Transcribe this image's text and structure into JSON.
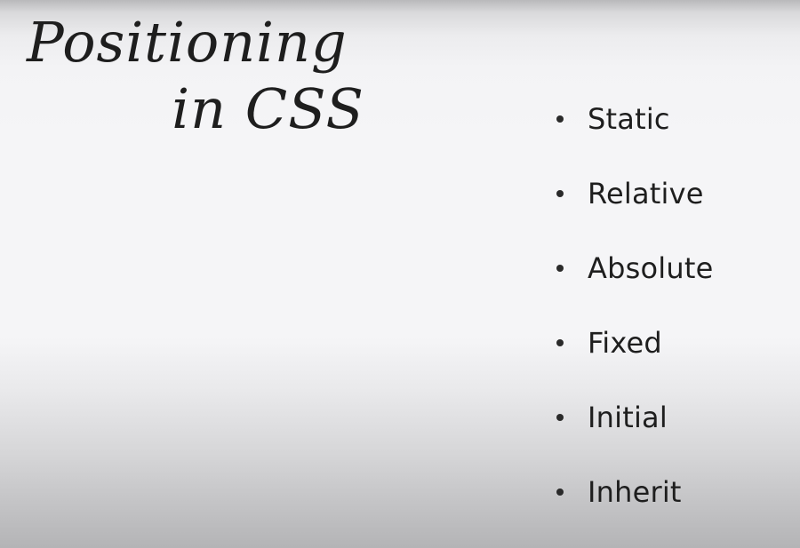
{
  "slide": {
    "title_line1": "Positioning",
    "title_line2": "in CSS",
    "bullets": [
      {
        "label": "Static"
      },
      {
        "label": "Relative"
      },
      {
        "label": "Absolute"
      },
      {
        "label": "Fixed"
      },
      {
        "label": "Initial"
      },
      {
        "label": "Inherit"
      }
    ]
  }
}
